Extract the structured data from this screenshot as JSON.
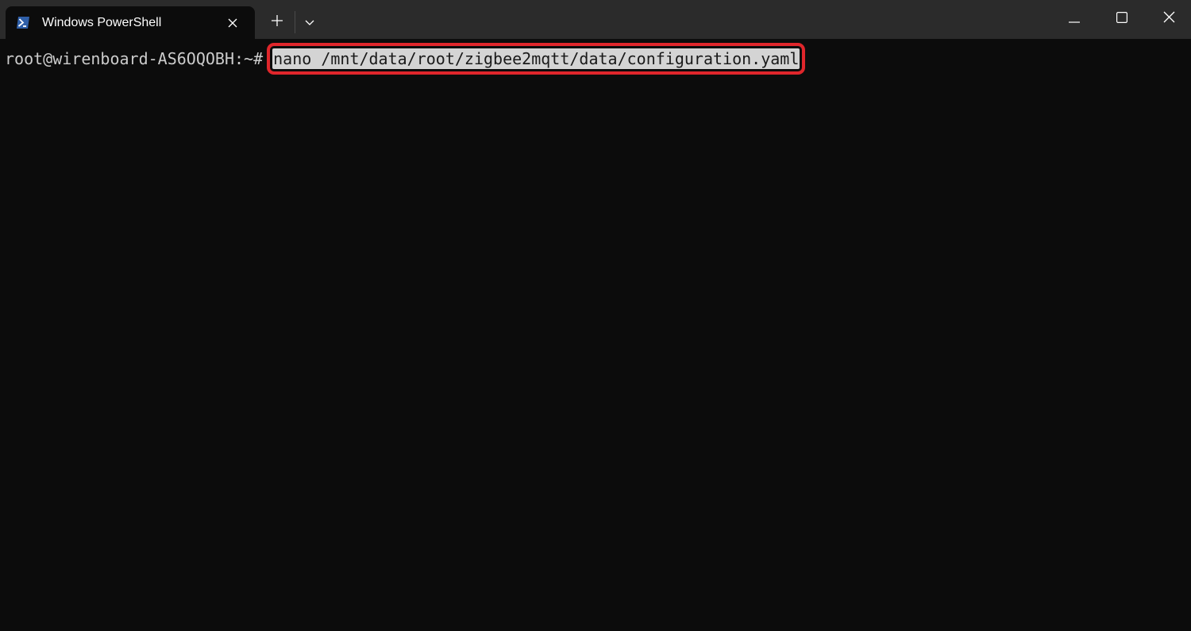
{
  "tab": {
    "title": "Windows PowerShell",
    "icon": "powershell-icon"
  },
  "titlebar": {
    "new_tab_icon": "plus-icon",
    "dropdown_icon": "chevron-down-icon",
    "minimize_icon": "minimize-icon",
    "maximize_icon": "maximize-icon",
    "close_icon": "close-icon"
  },
  "terminal": {
    "prompt": "root@wirenboard-AS6OQOBH:~#",
    "command": "nano /mnt/data/root/zigbee2mqtt/data/configuration.yaml"
  },
  "colors": {
    "titlebar_bg": "#2b2b2b",
    "terminal_bg": "#0c0c0c",
    "text": "#cccccc",
    "highlight_outline": "#e0262b",
    "selection_bg": "#d4d4d4",
    "powershell_blue": "#2f5fa8"
  }
}
